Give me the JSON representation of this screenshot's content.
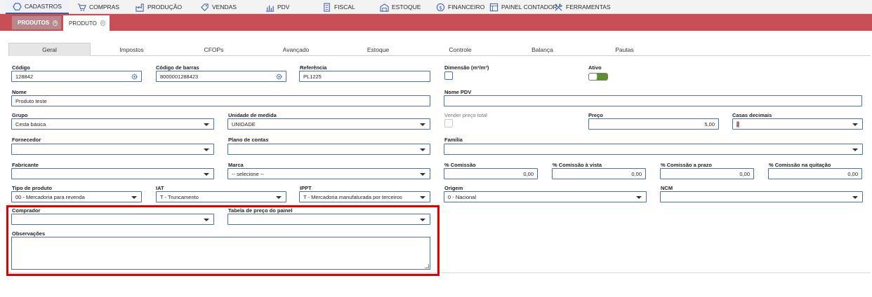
{
  "menu": {
    "items": [
      {
        "label": "CADASTROS",
        "icon": "hexagon-icon"
      },
      {
        "label": "COMPRAS",
        "icon": "cart-icon"
      },
      {
        "label": "PRODUÇÃO",
        "icon": "factory-icon"
      },
      {
        "label": "VENDAS",
        "icon": "tag-icon"
      },
      {
        "label": "PDV",
        "icon": "pdv-chart-icon"
      },
      {
        "label": "FISCAL",
        "icon": "document-icon"
      },
      {
        "label": "ESTOQUE",
        "icon": "warehouse-icon"
      },
      {
        "label": "FINANCEIRO",
        "icon": "dollar-icon"
      },
      {
        "label": "PAINEL CONTADOR",
        "icon": "calculator-icon"
      },
      {
        "label": "FERRAMENTAS",
        "icon": "tools-icon"
      }
    ]
  },
  "page_tabs": [
    {
      "label": "PRODUTOS"
    },
    {
      "label": "PRODUTO"
    }
  ],
  "sub_tabs": [
    "Geral",
    "Impostos",
    "CFOPs",
    "Avançado",
    "Estoque",
    "Controle",
    "Balança",
    "Pautas"
  ],
  "form": {
    "codigo": {
      "label": "Código",
      "value": "128842"
    },
    "codigo_barras": {
      "label": "Código de barras",
      "value": "8000001288423"
    },
    "referencia": {
      "label": "Referência",
      "value": "PL1225"
    },
    "dimensao": {
      "label": "Dimensão (m²/m³)"
    },
    "ativo": {
      "label": "Ativo"
    },
    "nome": {
      "label": "Nome",
      "value": "Produto teste"
    },
    "nome_pdv": {
      "label": "Nome PDV",
      "value": ""
    },
    "grupo": {
      "label": "Grupo",
      "value": "Cesta básica"
    },
    "unidade": {
      "label": "Unidade de medida",
      "value": "UNIDADE"
    },
    "vender_preco_total": {
      "label": "Vender preço total"
    },
    "preco": {
      "label": "Preço",
      "value": "5,00"
    },
    "casas_decimais": {
      "label": "Casas decimais",
      "value": "2"
    },
    "fornecedor": {
      "label": "Fornecedor",
      "value": ""
    },
    "plano_contas": {
      "label": "Plano de contas",
      "value": ""
    },
    "familia": {
      "label": "Família",
      "value": ""
    },
    "fabricante": {
      "label": "Fabricante",
      "value": ""
    },
    "marca": {
      "label": "Marca",
      "value": "-- selecione --"
    },
    "comissao": {
      "label": "% Comissão",
      "value": "0,00"
    },
    "comissao_vista": {
      "label": "% Comissão à vista",
      "value": "0,00"
    },
    "comissao_prazo": {
      "label": "% Comissão a prazo",
      "value": "0,00"
    },
    "comissao_quitacao": {
      "label": "% Comissão na quitação",
      "value": "0,00"
    },
    "tipo_produto": {
      "label": "Tipo de produto",
      "value": "00 - Mercadoria para revenda"
    },
    "iat": {
      "label": "IAT",
      "value": "T - Truncamento"
    },
    "ippt": {
      "label": "IPPT",
      "value": "T - Mercadoria manufaturada por terceiros"
    },
    "origem": {
      "label": "Origem",
      "value": "0 - Nacional"
    },
    "ncm": {
      "label": "NCM",
      "value": ""
    },
    "comprador": {
      "label": "Comprador",
      "value": ""
    },
    "tabela_preco": {
      "label": "Tabela de preço do painel",
      "value": ""
    },
    "observacoes": {
      "label": "Observações"
    }
  },
  "colors": {
    "accent": "#3a5da8",
    "tabbar": "#c84f57",
    "toggle_on": "#5e8f2a",
    "highlight": "#e00000"
  }
}
